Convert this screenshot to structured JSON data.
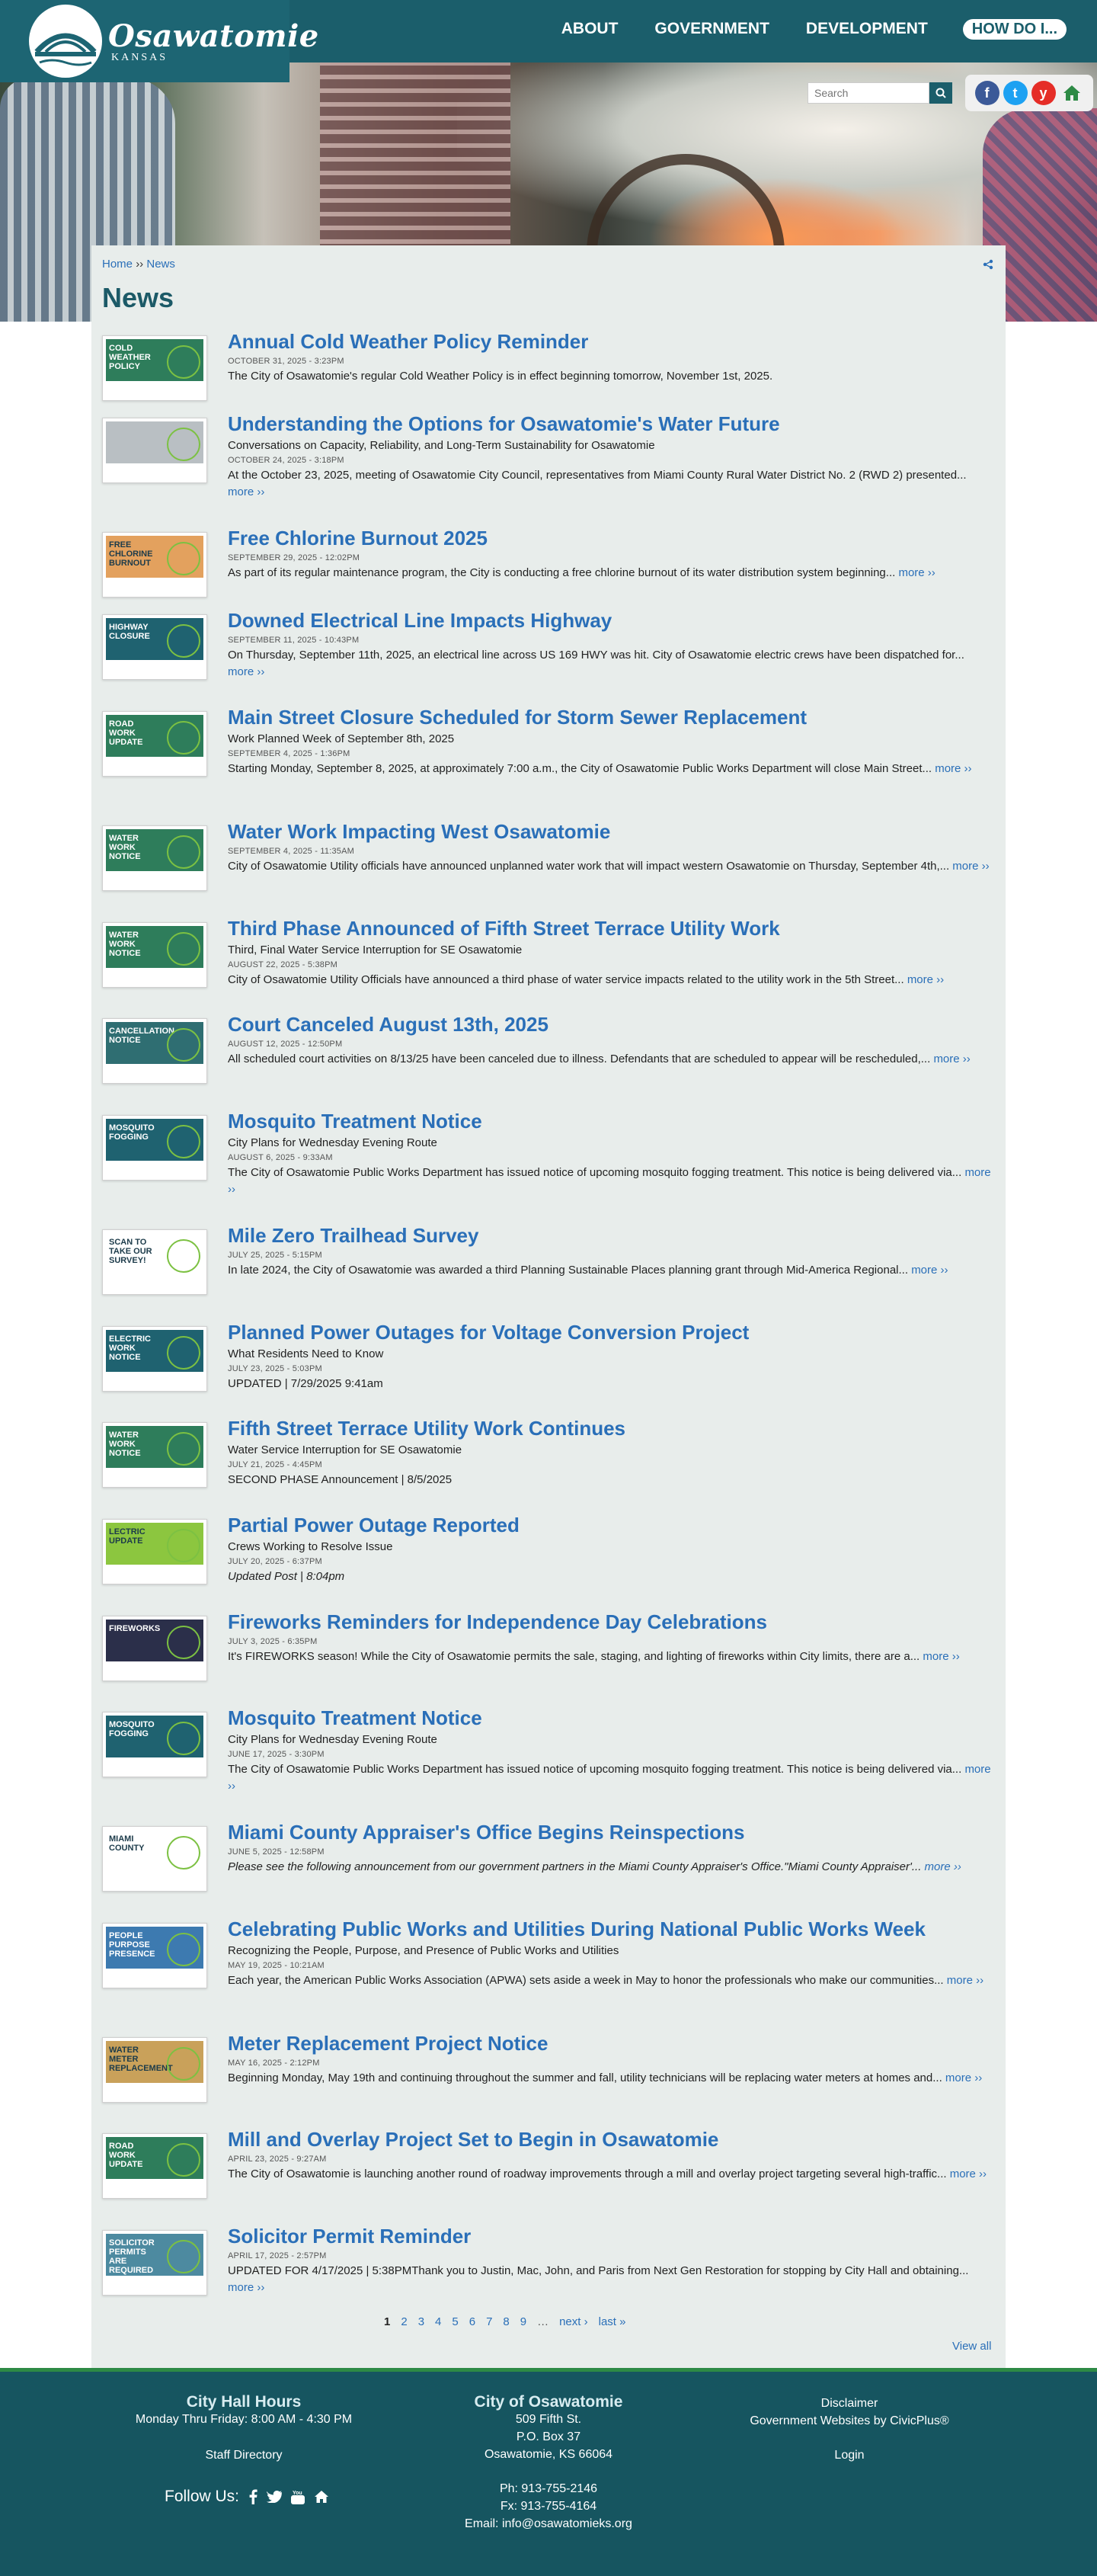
{
  "header": {
    "logo_name": "Osawatomie",
    "logo_state": "KANSAS",
    "nav": [
      "ABOUT",
      "GOVERNMENT",
      "DEVELOPMENT",
      "HOW DO I..."
    ]
  },
  "search": {
    "placeholder": "Search"
  },
  "social": {
    "facebook": "f",
    "twitter": "t",
    "youtube": "y"
  },
  "breadcrumb": {
    "home": "Home",
    "sep": "››",
    "current": "News"
  },
  "page_title": "News",
  "more_label": "more ››",
  "articles": [
    {
      "title": "Annual Cold Weather Policy Reminder",
      "subtitle": "",
      "date": "OCTOBER 31, 2025 - 3:23PM",
      "text": "The City of Osawatomie's regular Cold Weather Policy is in effect beginning tomorrow, November 1st, 2025.",
      "thumb_label": "COLD WEATHER POLICY",
      "thumb_color": "#2e7d5b"
    },
    {
      "title": "Understanding the Options for Osawatomie's Water Future",
      "subtitle": "Conversations on Capacity, Reliability, and Long-Term Sustainability for Osawatomie",
      "date": "OCTOBER 24, 2025 - 3:18PM",
      "text": "At the October 23, 2025, meeting of Osawatomie City Council, representatives from Miami County Rural Water District No. 2 (RWD 2) presented...",
      "thumb_label": "",
      "thumb_color": "#b9bfc3"
    },
    {
      "title": "Free Chlorine Burnout 2025",
      "subtitle": "",
      "date": "SEPTEMBER 29, 2025 - 12:02PM",
      "text": "As part of its regular maintenance program, the City is conducting a free chlorine burnout of its water distribution system beginning...",
      "thumb_label": "FREE CHLORINE BURNOUT",
      "thumb_color": "#e3a15e"
    },
    {
      "title": "Downed Electrical Line Impacts Highway",
      "subtitle": "",
      "date": "SEPTEMBER 11, 2025 - 10:43PM",
      "text": "On Thursday, September 11th, 2025, an electrical line across US 169 HWY was hit. City of Osawatomie electric crews have been dispatched for...",
      "thumb_label": "HIGHWAY CLOSURE",
      "thumb_color": "#1f6270"
    },
    {
      "title": "Main Street Closure Scheduled for Storm Sewer Replacement",
      "subtitle": "Work Planned Week of September 8th, 2025",
      "date": "SEPTEMBER 4, 2025 - 1:36PM",
      "text": "Starting Monday, September 8, 2025, at approximately 7:00 a.m., the City of Osawatomie Public Works Department will close Main Street...",
      "thumb_label": "ROAD WORK UPDATE",
      "thumb_color": "#2e7d5b"
    },
    {
      "title": "Water Work Impacting West Osawatomie",
      "subtitle": "",
      "date": "SEPTEMBER 4, 2025 - 11:35AM",
      "text": "City of Osawatomie Utility officials have announced unplanned water work that will impact western Osawatomie on Thursday, September 4th,...",
      "thumb_label": "WATER WORK NOTICE",
      "thumb_color": "#2e7d5b"
    },
    {
      "title": "Third Phase Announced of Fifth Street Terrace Utility Work",
      "subtitle": "Third, Final Water Service Interruption for SE Osawatomie",
      "date": "AUGUST 22, 2025 - 5:38PM",
      "text": "City of Osawatomie Utility Officials have announced a third phase of water service impacts related to the utility work in the 5th Street...",
      "thumb_label": "WATER WORK NOTICE",
      "thumb_color": "#2e7d5b"
    },
    {
      "title": "Court Canceled August 13th, 2025",
      "subtitle": "",
      "date": "AUGUST 12, 2025 - 12:50PM",
      "text": "All scheduled court activities on 8/13/25 have been canceled due to illness. Defendants that are scheduled to appear will be rescheduled,...",
      "thumb_label": "CANCELLATION NOTICE",
      "thumb_color": "#2f6e72"
    },
    {
      "title": "Mosquito Treatment Notice",
      "subtitle": "City Plans for Wednesday Evening Route",
      "date": "AUGUST 6, 2025 - 9:33AM",
      "text": "The City of Osawatomie Public Works Department has issued notice of upcoming mosquito fogging treatment. This notice is being delivered via...",
      "thumb_label": "MOSQUITO FOGGING",
      "thumb_color": "#1f6270"
    },
    {
      "title": "Mile Zero Trailhead Survey",
      "subtitle": "",
      "date": "JULY 25, 2025 - 5:15PM",
      "text": "In late 2024, the City of Osawatomie was awarded a third Planning Sustainable Places planning grant through Mid-America Regional...",
      "thumb_label": "SCAN TO TAKE OUR SURVEY!",
      "thumb_color": "#ffffff"
    },
    {
      "title": "Planned Power Outages for Voltage Conversion Project",
      "subtitle": "What Residents Need to Know",
      "date": "JULY 23, 2025 - 5:03PM",
      "text": "UPDATED | 7/29/2025 9:41am",
      "thumb_label": "ELECTRIC WORK NOTICE",
      "thumb_color": "#1f6270"
    },
    {
      "title": "Fifth Street Terrace Utility Work Continues",
      "subtitle": "Water Service Interruption for SE Osawatomie",
      "date": "JULY 21, 2025 - 4:45PM",
      "text": "SECOND PHASE Announcement | 8/5/2025",
      "thumb_label": "WATER WORK NOTICE",
      "thumb_color": "#2e7d5b"
    },
    {
      "title": "Partial Power Outage Reported",
      "subtitle": "Crews Working to Resolve Issue",
      "date": "JULY 20, 2025 - 6:37PM",
      "text": "Updated Post | 8:04pm",
      "thumb_label": "LECTRIC UPDATE",
      "thumb_color": "#8cc63f"
    },
    {
      "title": "Fireworks Reminders for Independence Day Celebrations",
      "subtitle": "",
      "date": "JULY 3, 2025 - 6:35PM",
      "text": "It's FIREWORKS season! While the City of Osawatomie permits the sale, staging, and lighting of fireworks within City limits, there are a...",
      "thumb_label": "FIREWORKS",
      "thumb_color": "#2b2f4a"
    },
    {
      "title": "Mosquito Treatment Notice",
      "subtitle": "City Plans for Wednesday Evening Route",
      "date": "JUNE 17, 2025 - 3:30PM",
      "text": "The City of Osawatomie Public Works Department has issued notice of upcoming mosquito fogging treatment. This notice is being delivered via...",
      "thumb_label": "MOSQUITO FOGGING",
      "thumb_color": "#1f6270"
    },
    {
      "title": "Miami County Appraiser's Office Begins Reinspections",
      "subtitle": "",
      "date": "JUNE 5, 2025 - 12:58PM",
      "text": "Please see the following announcement from our government partners in the Miami County Appraiser's Office.\"Miami County Appraiser'...",
      "thumb_label": "MIAMI COUNTY",
      "thumb_color": "#ffffff"
    },
    {
      "title": "Celebrating Public Works and Utilities During National Public Works Week",
      "subtitle": "Recognizing the People, Purpose, and Presence of Public Works and Utilities",
      "date": "MAY 19, 2025 - 10:21AM",
      "text": "Each year, the American Public Works Association (APWA) sets aside a week in May to honor the professionals who make our communities...",
      "thumb_label": "PEOPLE PURPOSE PRESENCE",
      "thumb_color": "#3d7ab0"
    },
    {
      "title": "Meter Replacement Project Notice",
      "subtitle": "",
      "date": "MAY 16, 2025 - 2:12PM",
      "text": "Beginning Monday, May 19th and continuing throughout the summer and fall, utility technicians will be replacing water meters at homes and...",
      "thumb_label": "WATER METER REPLACEMENT",
      "thumb_color": "#c9a15a"
    },
    {
      "title": "Mill and Overlay Project Set to Begin in Osawatomie",
      "subtitle": "",
      "date": "APRIL 23, 2025 - 9:27AM",
      "text": "The City of Osawatomie is launching another round of roadway improvements through a mill and overlay project targeting several high-traffic...",
      "thumb_label": "ROAD WORK UPDATE",
      "thumb_color": "#2e7d5b"
    },
    {
      "title": "Solicitor Permit Reminder",
      "subtitle": "",
      "date": "APRIL 17, 2025 - 2:57PM",
      "text": "UPDATED FOR 4/17/2025 | 5:38PMThank you to Justin, Mac, John, and Paris from Next Gen Restoration for stopping by City Hall and obtaining...",
      "thumb_label": "Solicitor Permits Are REQUIRED",
      "thumb_color": "#4d8aa0"
    }
  ],
  "pager": [
    "1",
    "2",
    "3",
    "4",
    "5",
    "6",
    "7",
    "8",
    "9",
    "…",
    "next ›",
    "last »"
  ],
  "view_all": "View all",
  "footer": {
    "hours_title": "City Hall Hours",
    "hours": "Monday Thru Friday: 8:00 AM - 4:30 PM",
    "staff_directory": "Staff Directory",
    "follow_us": "Follow Us:",
    "city_title": "City of Osawatomie",
    "address1": "509 Fifth St.",
    "address2": "P.O. Box 37",
    "address3": "Osawatomie, KS 66064",
    "phone": "Ph: 913-755-2146",
    "fax": "Fx: 913-755-4164",
    "email": "Email: info@osawatomieks.org",
    "disclaimer": "Disclaimer",
    "gov_websites": "Government Websites by CivicPlus®",
    "login": "Login"
  }
}
